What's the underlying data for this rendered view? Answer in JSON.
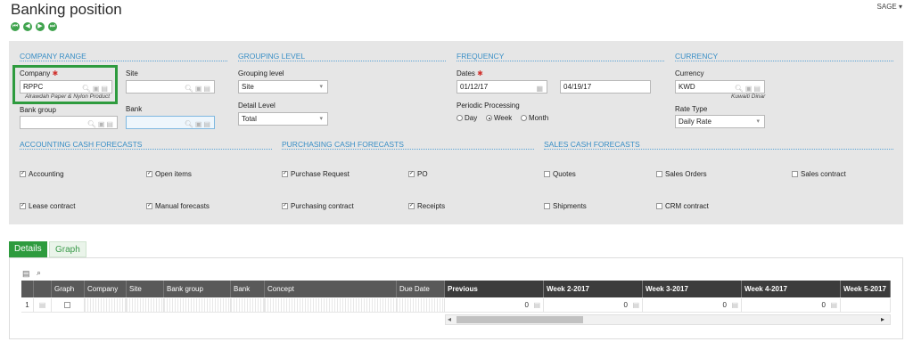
{
  "header": {
    "title": "Banking position",
    "user": "SAGE"
  },
  "sections": {
    "company_range": "COMPANY RANGE",
    "grouping_level": "GROUPING LEVEL",
    "frequency": "FREQUENCY",
    "currency": "CURRENCY",
    "accounting_cash": "ACCOUNTING CASH FORECASTS",
    "purchasing_cash": "PURCHASING CASH FORECASTS",
    "sales_cash": "SALES CASH FORECASTS"
  },
  "fields": {
    "company_label": "Company",
    "company_value": "RPPC",
    "company_hint": "Alrawdah Paper & Nylon Product",
    "site_label": "Site",
    "bank_group_label": "Bank group",
    "bank_label": "Bank",
    "grouping_label": "Grouping level",
    "grouping_value": "Site",
    "detail_label": "Detail Level",
    "detail_value": "Total",
    "dates_label": "Dates",
    "date_from": "01/12/17",
    "date_to": "04/19/17",
    "periodic_label": "Periodic Processing",
    "period_options": [
      "Day",
      "Week",
      "Month"
    ],
    "period_selected": "Week",
    "currency_label": "Currency",
    "currency_value": "KWD",
    "currency_hint": "Kuwaiti Dinar",
    "rate_type_label": "Rate Type",
    "rate_type_value": "Daily Rate"
  },
  "checkboxes": [
    {
      "label": "Accounting",
      "checked": true
    },
    {
      "label": "Open items",
      "checked": true
    },
    {
      "label": "Purchase Request",
      "checked": true
    },
    {
      "label": "PO",
      "checked": true
    },
    {
      "label": "Quotes",
      "checked": false
    },
    {
      "label": "Sales Orders",
      "checked": false
    },
    {
      "label": "Sales contract",
      "checked": false
    },
    {
      "label": "Lease contract",
      "checked": true
    },
    {
      "label": "Manual forecasts",
      "checked": true
    },
    {
      "label": "Purchasing contract",
      "checked": true
    },
    {
      "label": "Receipts",
      "checked": true
    },
    {
      "label": "Shipments",
      "checked": false
    },
    {
      "label": "CRM contract",
      "checked": false
    }
  ],
  "tabs": [
    "Details",
    "Graph"
  ],
  "grid": {
    "columns": [
      "Graph",
      "Company",
      "Site",
      "Bank group",
      "Bank",
      "Concept",
      "Due Date",
      "Previous",
      "Week 2-2017",
      "Week 3-2017",
      "Week 4-2017",
      "Week 5-2017"
    ],
    "row_number": "1",
    "values": [
      "0",
      "0",
      "0",
      "0"
    ]
  },
  "colors": {
    "accent_green": "#2e9b3e",
    "section_blue": "#3a8fc6",
    "grid_header": "#595959"
  }
}
